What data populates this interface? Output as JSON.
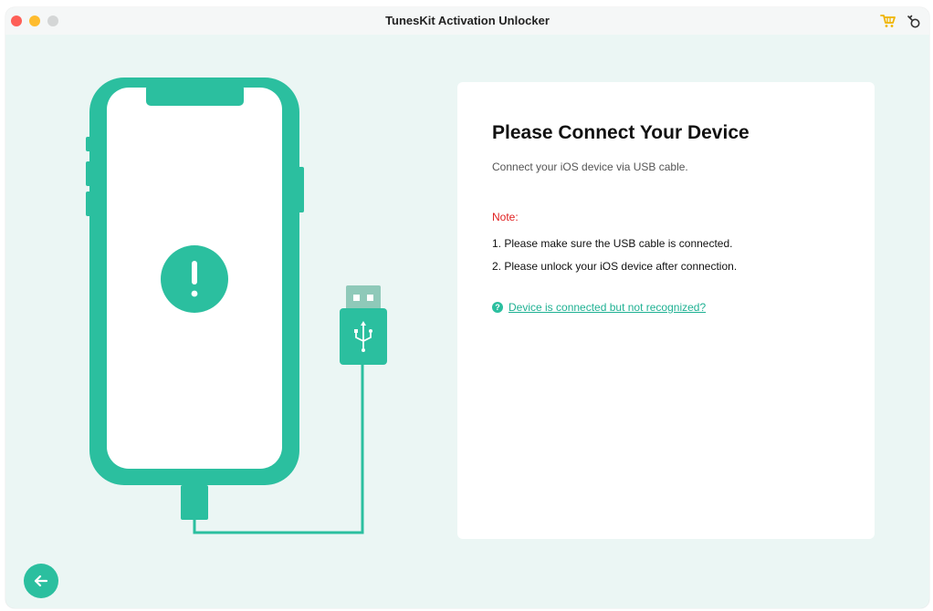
{
  "window": {
    "title": "TunesKit Activation Unlocker",
    "toolbar_icons": [
      "cart-icon",
      "key-icon"
    ]
  },
  "illustration": {
    "device_icon": "exclamation-icon",
    "usb_icon": "usb-icon"
  },
  "card": {
    "title": "Please Connect Your Device",
    "subtitle": "Connect your iOS device via USB cable.",
    "note_label": "Note:",
    "notes": [
      "1. Please make sure the USB cable is connected.",
      "2. Please unlock your iOS device after connection."
    ],
    "help_icon": "?",
    "help_link": "Device is connected but not recognized?"
  },
  "navigation": {
    "back_icon": "arrow-left-icon"
  },
  "colors": {
    "accent": "#2bbf9f",
    "accent_dark": "#26a98e",
    "note_red": "#e02020",
    "background": "#ebf6f4"
  }
}
